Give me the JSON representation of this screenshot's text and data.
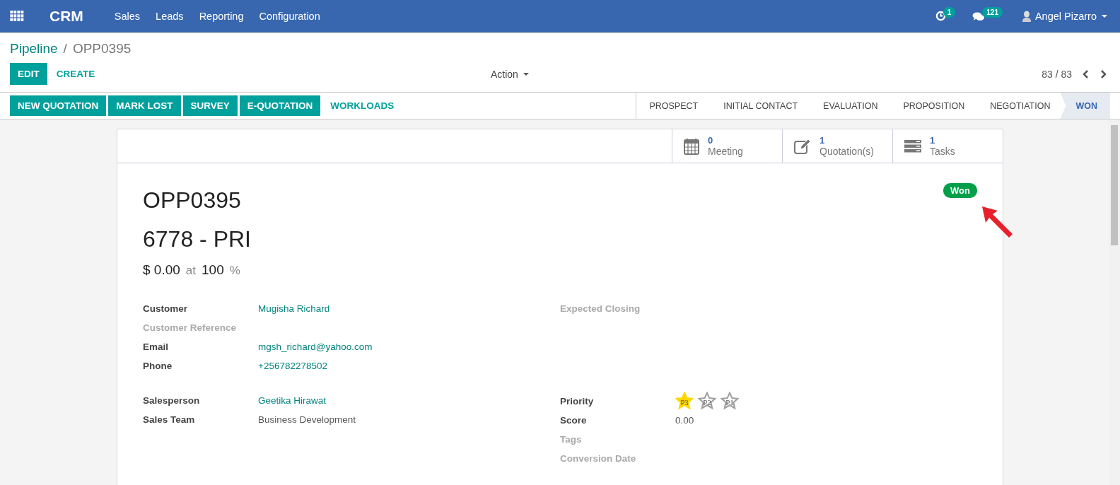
{
  "navbar": {
    "app_name": "CRM",
    "menu": [
      {
        "label": "Sales"
      },
      {
        "label": "Leads"
      },
      {
        "label": "Reporting"
      },
      {
        "label": "Configuration"
      }
    ],
    "activity_count": "1",
    "message_count": "121",
    "user": "Angel Pizarro"
  },
  "breadcrumb": {
    "parent": "Pipeline",
    "separator": "/",
    "current": "OPP0395"
  },
  "buttons": {
    "edit": "EDIT",
    "create": "CREATE",
    "action": "Action"
  },
  "pager": {
    "value": "83 / 83"
  },
  "header_buttons": [
    {
      "label": "NEW QUOTATION",
      "kind": "primary"
    },
    {
      "label": "MARK LOST",
      "kind": "primary"
    },
    {
      "label": "SURVEY",
      "kind": "primary"
    },
    {
      "label": "E-QUOTATION",
      "kind": "primary"
    },
    {
      "label": "WORKLOADS",
      "kind": "link"
    }
  ],
  "stages": [
    {
      "label": "PROSPECT",
      "selected": false
    },
    {
      "label": "INITIAL CONTACT",
      "selected": false
    },
    {
      "label": "EVALUATION",
      "selected": false
    },
    {
      "label": "PROPOSITION",
      "selected": false
    },
    {
      "label": "NEGOTIATION",
      "selected": false
    },
    {
      "label": "WON",
      "selected": true
    }
  ],
  "smart_buttons": [
    {
      "kind": "calendar",
      "count": "0",
      "label": "Meeting"
    },
    {
      "kind": "edit",
      "count": "1",
      "label": "Quotation(s)"
    },
    {
      "kind": "tasks",
      "count": "1",
      "label": "Tasks"
    }
  ],
  "ribbon": {
    "label": "Won"
  },
  "record": {
    "name": "OPP0395",
    "title": "6778 - PRI",
    "amount": "$ 0.00",
    "at": "at",
    "probability": "100",
    "percent": "%"
  },
  "left_fields": [
    {
      "label": "Customer",
      "value": "Mugisha Richard",
      "link": true,
      "empty": false
    },
    {
      "label": "Customer Reference",
      "empty": true
    },
    {
      "label": "Email",
      "value": "mgsh_richard@yahoo.com",
      "link": true,
      "empty": false
    },
    {
      "label": "Phone",
      "value": "+256782278502",
      "link": true,
      "empty": false
    }
  ],
  "left_fields_2": [
    {
      "label": "Salesperson",
      "value": "Geetika Hirawat",
      "link": true,
      "empty": false
    },
    {
      "label": "Sales Team",
      "value": "Business Development",
      "link": false,
      "empty": false
    }
  ],
  "right_fields": [
    {
      "label": "Expected Closing",
      "empty": true
    }
  ],
  "right_fields_2": [
    {
      "label": "Priority",
      "kind": "priority",
      "empty": false,
      "stars": 1,
      "star_labels": [
        "P3",
        "P2",
        "P1"
      ]
    },
    {
      "label": "Score",
      "kind": "text",
      "value": "0.00",
      "link": false,
      "empty": false
    },
    {
      "label": "Tags",
      "kind": "text",
      "empty": true
    },
    {
      "label": "Conversion Date",
      "kind": "text",
      "empty": true
    }
  ]
}
